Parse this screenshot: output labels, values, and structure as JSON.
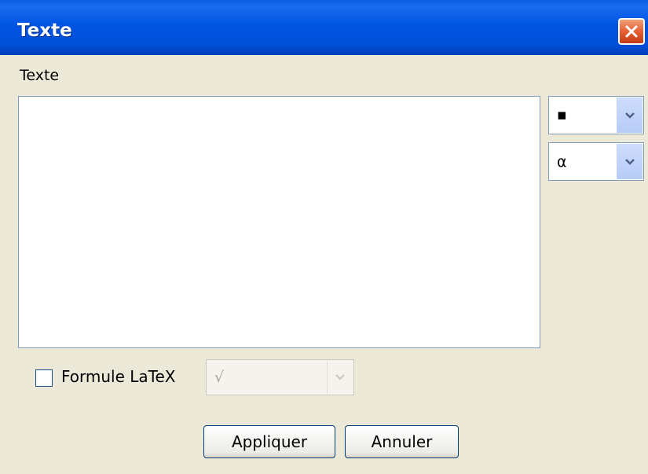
{
  "window": {
    "title": "Texte"
  },
  "label": "Texte",
  "textarea": {
    "value": ""
  },
  "combos": {
    "symbol": {
      "value": "▪"
    },
    "greek": {
      "value": "α"
    },
    "latex": {
      "value": "√"
    }
  },
  "checkbox": {
    "label": "Formule LaTeX",
    "checked": false
  },
  "buttons": {
    "apply": "Appliquer",
    "cancel": "Annuler"
  }
}
